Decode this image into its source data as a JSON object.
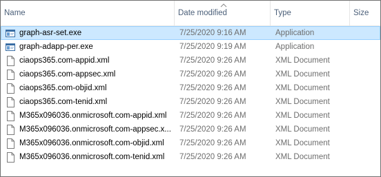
{
  "columns": {
    "name": "Name",
    "date": "Date modified",
    "type": "Type",
    "size": "Size"
  },
  "sort": {
    "column": "date",
    "direction": "ascending",
    "icon": "sort-up-caret-icon"
  },
  "files": [
    {
      "name": "graph-asr-set.exe",
      "date": "7/25/2020 9:16 AM",
      "type": "Application",
      "icon": "exe-icon",
      "selected": true
    },
    {
      "name": "graph-adapp-per.exe",
      "date": "7/25/2020 9:19 AM",
      "type": "Application",
      "icon": "exe-icon",
      "selected": false
    },
    {
      "name": "ciaops365.com-appid.xml",
      "date": "7/25/2020 9:26 AM",
      "type": "XML Document",
      "icon": "document-icon",
      "selected": false
    },
    {
      "name": "ciaops365.com-appsec.xml",
      "date": "7/25/2020 9:26 AM",
      "type": "XML Document",
      "icon": "document-icon",
      "selected": false
    },
    {
      "name": "ciaops365.com-objid.xml",
      "date": "7/25/2020 9:26 AM",
      "type": "XML Document",
      "icon": "document-icon",
      "selected": false
    },
    {
      "name": "ciaops365.com-tenid.xml",
      "date": "7/25/2020 9:26 AM",
      "type": "XML Document",
      "icon": "document-icon",
      "selected": false
    },
    {
      "name": "M365x096036.onmicrosoft.com-appid.xml",
      "date": "7/25/2020 9:26 AM",
      "type": "XML Document",
      "icon": "document-icon",
      "selected": false
    },
    {
      "name": "M365x096036.onmicrosoft.com-appsec.x...",
      "date": "7/25/2020 9:26 AM",
      "type": "XML Document",
      "icon": "document-icon",
      "selected": false
    },
    {
      "name": "M365x096036.onmicrosoft.com-objid.xml",
      "date": "7/25/2020 9:26 AM",
      "type": "XML Document",
      "icon": "document-icon",
      "selected": false
    },
    {
      "name": "M365x096036.onmicrosoft.com-tenid.xml",
      "date": "7/25/2020 9:26 AM",
      "type": "XML Document",
      "icon": "document-icon",
      "selected": false
    }
  ],
  "colors": {
    "selection_bg": "#cce8ff",
    "selection_border": "#99d1ff",
    "header_text": "#4c607a",
    "secondary_text": "#6d6d6d"
  }
}
